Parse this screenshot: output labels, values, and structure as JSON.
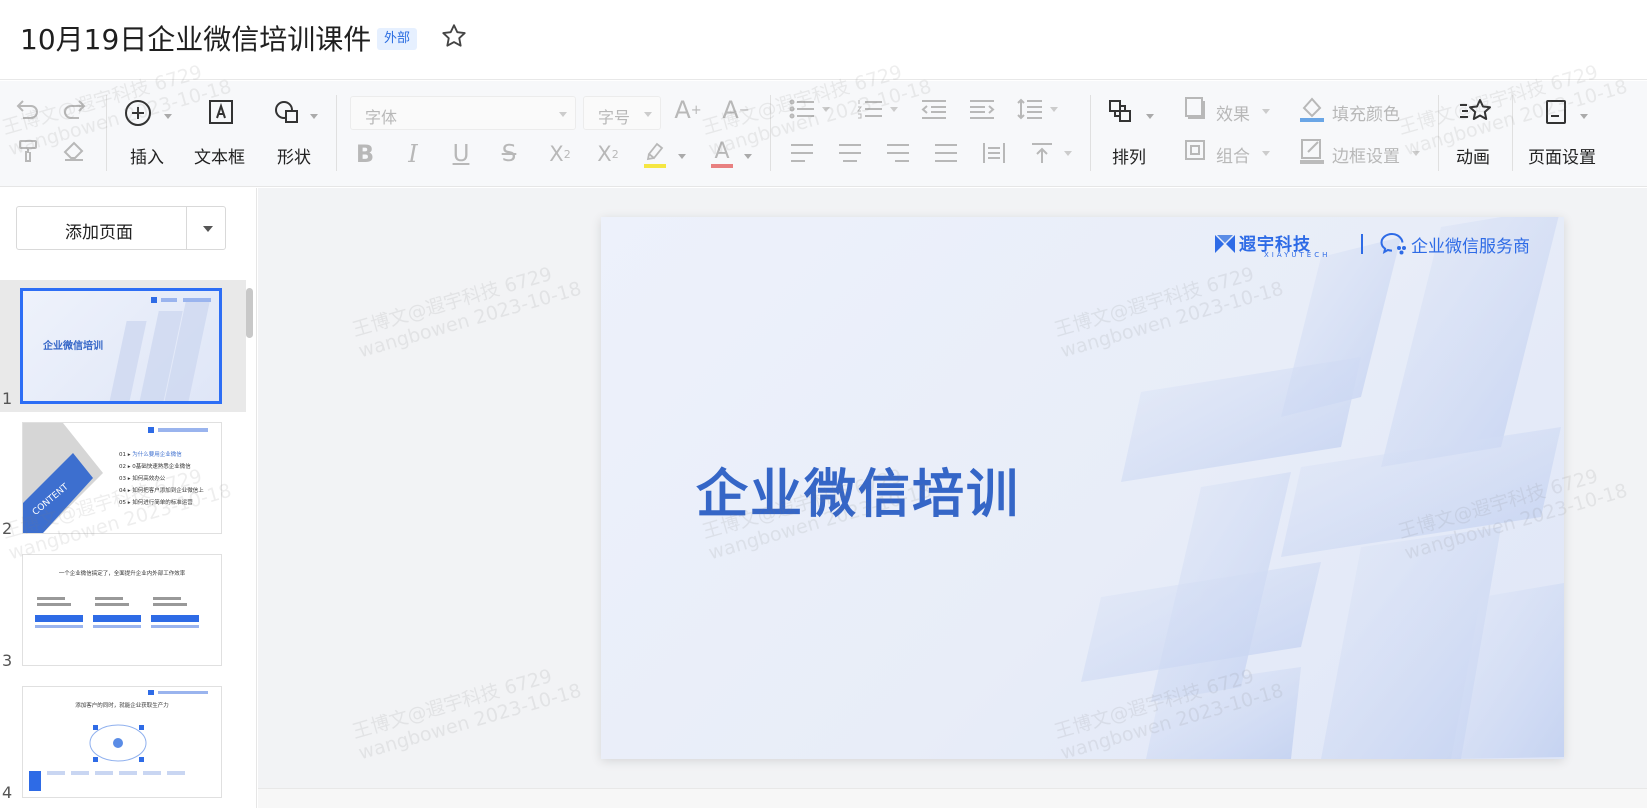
{
  "doc": {
    "title": "10月19日企业微信培训课件",
    "badge": "外部"
  },
  "toolbar": {
    "insert": "插入",
    "textbox": "文本框",
    "shape": "形状",
    "font_placeholder": "字体",
    "size_placeholder": "字号",
    "arrange": "排列",
    "effect": "效果",
    "group": "组合",
    "fill_color": "填充颜色",
    "border_settings": "边框设置",
    "animation": "动画",
    "page_setup": "页面设置",
    "font_color": "#e04a4a",
    "highlight_color": "#f5e642",
    "fill_swatch": "#6aa6e6"
  },
  "sidebar": {
    "add_page": "添加页面",
    "slides": [
      {
        "num": "1",
        "title": "企业微信培训"
      },
      {
        "num": "2",
        "title": "CONTENT",
        "items": [
          "01",
          "为什么要用企业微信",
          "02",
          "0基础快速熟悉企业微信",
          "03",
          "如何高效办公",
          "04",
          "如何把客户添加到企业微信上",
          "05",
          "如何进行简单的标准运营"
        ]
      },
      {
        "num": "3",
        "title": "一个企业微信搞定了，全面提升企业内外部工作效率"
      },
      {
        "num": "4",
        "title": "添加客户的同时，就能企业获取生产力"
      }
    ]
  },
  "slide": {
    "title": "企业微信培训",
    "brand": "遐宇科技",
    "brand_sub": "XIAYUTECH",
    "service": "企业微信服务商"
  },
  "watermark": {
    "line1": "王博文@遐宇科技 6729",
    "line2": "wangbowen 2023-10-18"
  }
}
